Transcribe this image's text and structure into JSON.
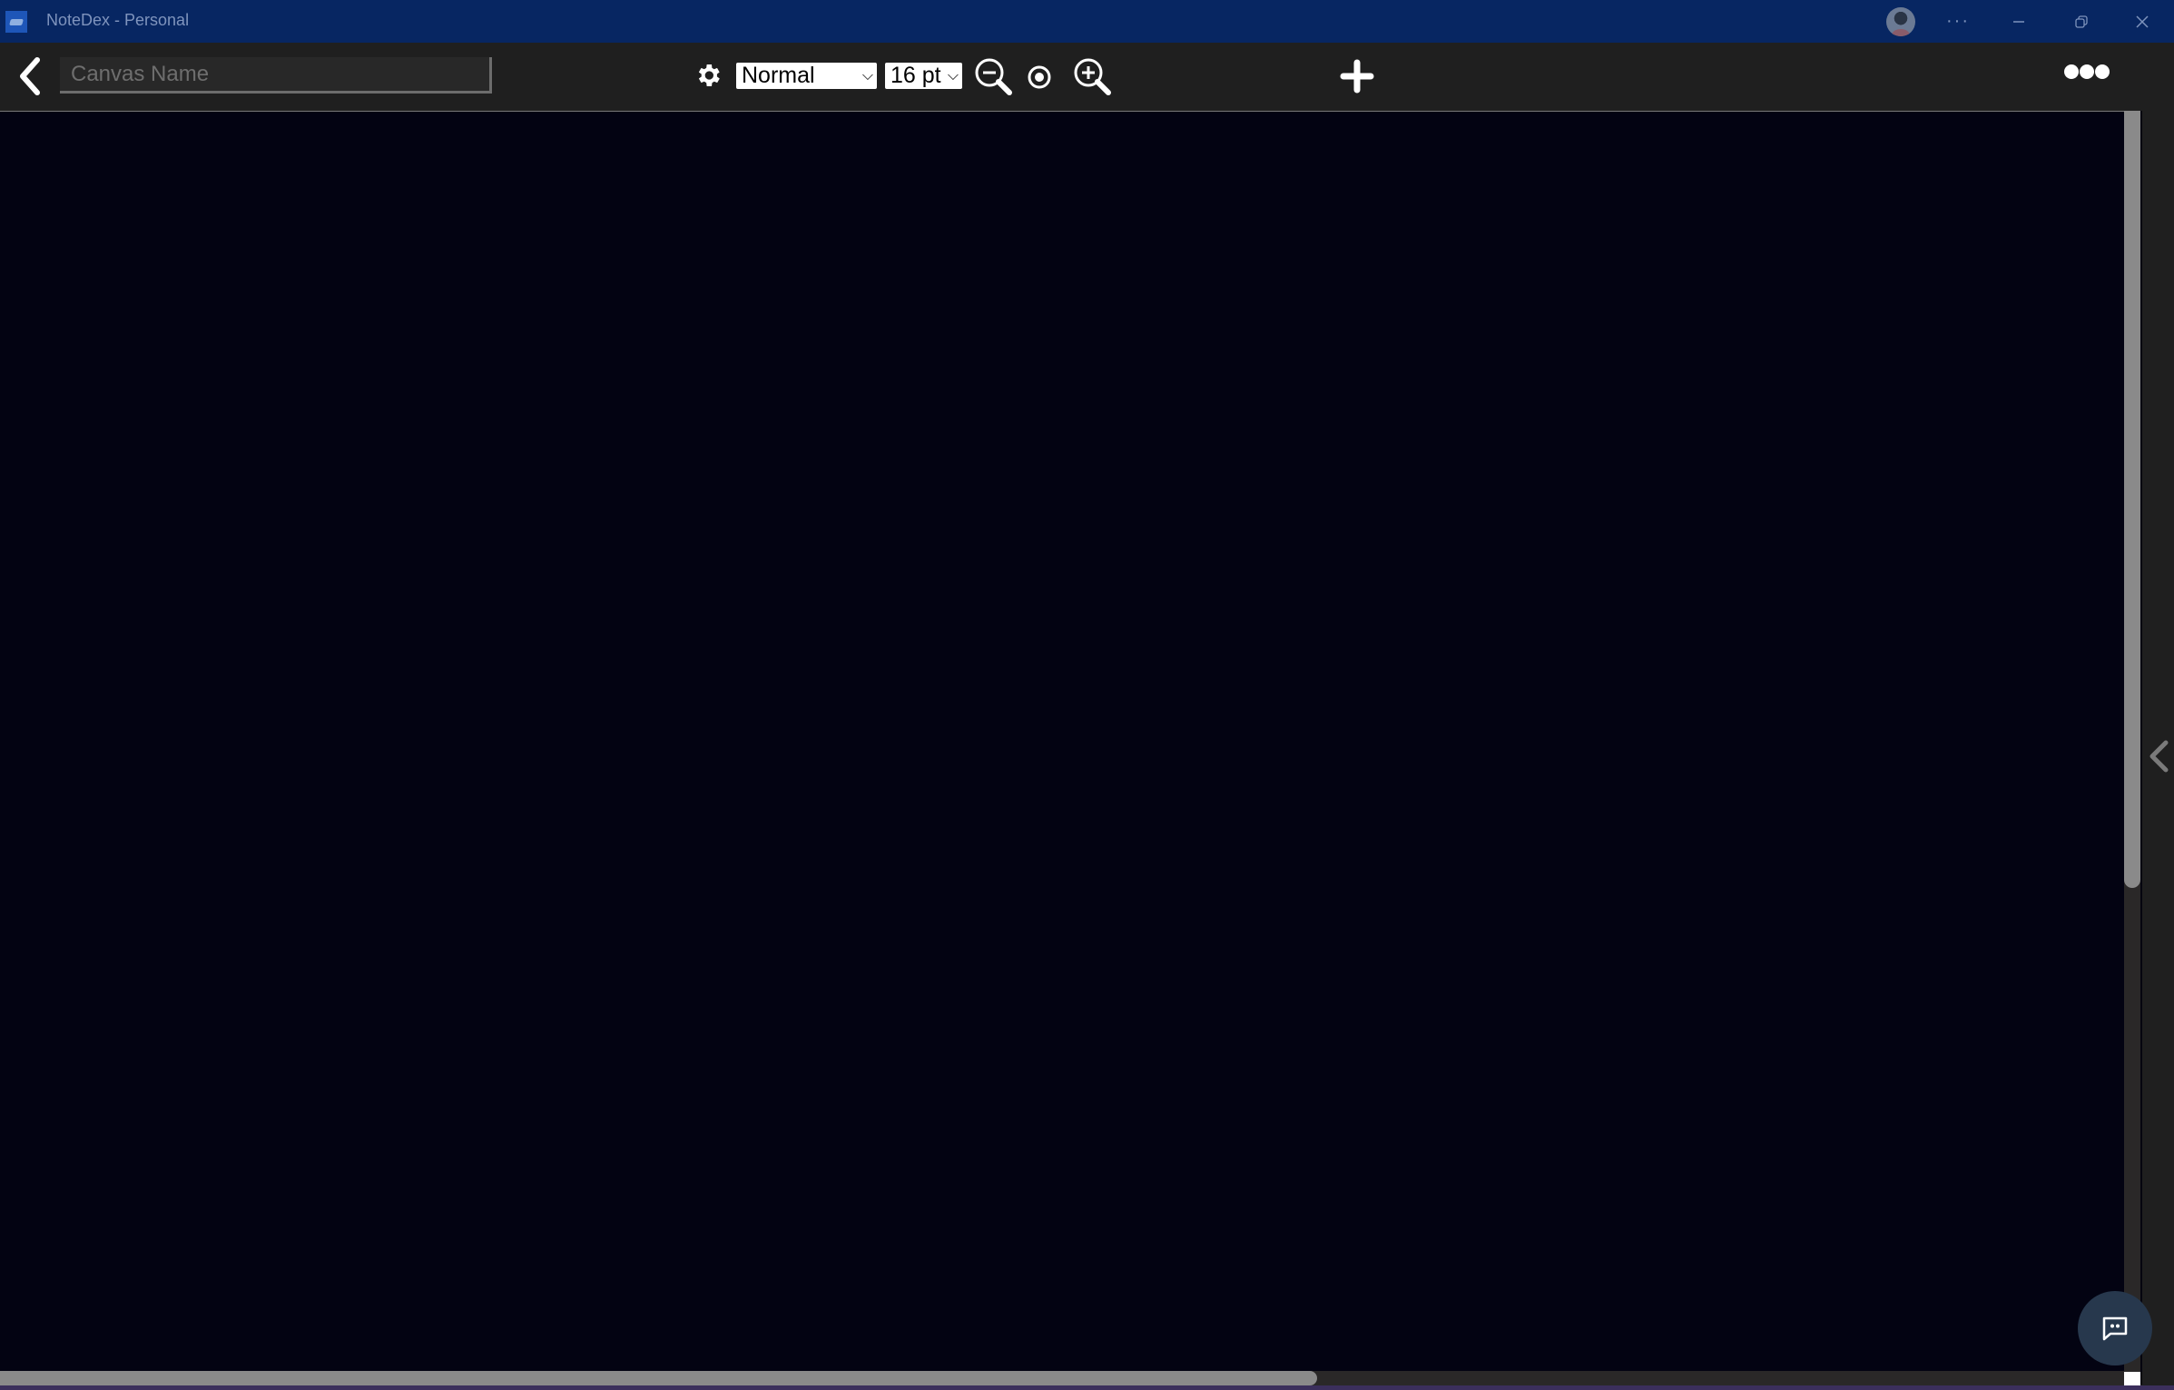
{
  "window": {
    "title": "NoteDex - Personal",
    "controls": {
      "more": "more-options-icon",
      "minimize": "minimize-icon",
      "restore": "restore-icon",
      "close": "close-icon"
    }
  },
  "toolbar": {
    "back_icon": "chevron-left-icon",
    "canvas_name": {
      "value": "",
      "placeholder": "Canvas Name"
    },
    "settings_icon": "gear-icon",
    "text_style": {
      "selected": "Normal"
    },
    "font_size": {
      "selected": "16 pt"
    },
    "zoom_out_icon": "zoom-out-icon",
    "zoom_reset_icon": "target-icon",
    "zoom_in_icon": "zoom-in-icon",
    "add_icon": "plus-icon",
    "more_icon": "more-horizontal-icon"
  },
  "canvas": {
    "background": "#030312",
    "vertical_scroll_fraction_visible": 0.61,
    "horizontal_scroll_fraction_visible": 0.62
  },
  "side_panel": {
    "toggle_icon": "chevron-left-icon"
  },
  "chat": {
    "icon": "chat-bubble-icon"
  },
  "colors": {
    "titlebar": "#072662",
    "toolbar": "#1f1f1f",
    "canvas": "#030312",
    "fab": "#27384d"
  }
}
